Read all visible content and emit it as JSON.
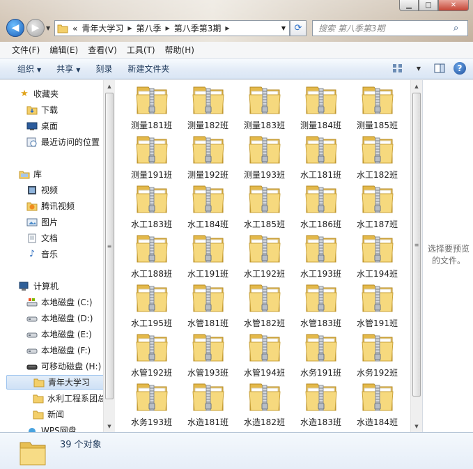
{
  "window": {
    "controls": {
      "minimize": "▁",
      "maximize": "□",
      "close": "✕"
    }
  },
  "address": {
    "prefix": "«",
    "segments": [
      "青年大学习",
      "第八季",
      "第八季第3期"
    ]
  },
  "search": {
    "placeholder": "搜索 第八季第3期"
  },
  "menu": [
    "文件(F)",
    "编辑(E)",
    "查看(V)",
    "工具(T)",
    "帮助(H)"
  ],
  "toolbar": {
    "organize": "组织",
    "share": "共享",
    "burn": "刻录",
    "new_folder": "新建文件夹"
  },
  "nav": {
    "favorites_header": "收藏夹",
    "favorites": [
      "下载",
      "桌面",
      "最近访问的位置"
    ],
    "libraries_header": "库",
    "libraries": [
      "视频",
      "腾讯视频",
      "图片",
      "文档",
      "音乐"
    ],
    "computer_header": "计算机",
    "drives": [
      "本地磁盘 (C:)",
      "本地磁盘 (D:)",
      "本地磁盘 (E:)",
      "本地磁盘 (F:)",
      "可移动磁盘 (H:)"
    ],
    "folders": [
      "青年大学习",
      "水利工程系团总",
      "新闻"
    ],
    "wps": "WPS网盘"
  },
  "files": [
    "测量181班",
    "测量182班",
    "测量183班",
    "测量184班",
    "测量185班",
    "测量191班",
    "测量192班",
    "测量193班",
    "水工181班",
    "水工182班",
    "水工183班",
    "水工184班",
    "水工185班",
    "水工186班",
    "水工187班",
    "水工188班",
    "水工191班",
    "水工192班",
    "水工193班",
    "水工194班",
    "水工195班",
    "水管181班",
    "水管182班",
    "水管183班",
    "水管191班",
    "水管192班",
    "水管193班",
    "水管194班",
    "水务191班",
    "水务192班",
    "水务193班",
    "水造181班",
    "水造182班",
    "水造183班",
    "水造184班"
  ],
  "preview_text": "选择要预览的文件。",
  "status": {
    "count_text": "39 个对象"
  },
  "colors": {
    "folder": "#f5d77e",
    "accent": "#1e395b",
    "selection": "#cfe1f6"
  }
}
